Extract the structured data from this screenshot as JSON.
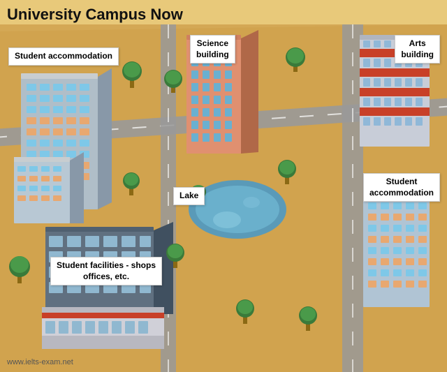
{
  "title": "University Campus Now",
  "labels": {
    "student_accommodation_left": "Student\naccommodation",
    "science_building": "Science\nbuilding",
    "arts_building": "Arts\nbuilding",
    "lake": "Lake",
    "student_facilities": "Student facilities - shops\noffices, etc.",
    "student_accommodation_right": "Student\naccommodation"
  },
  "watermark": "www.ielts-exam.net",
  "colors": {
    "ground": "#d4a855",
    "road": "#888888",
    "lake": "#5a9ab8",
    "building_science_front": "#e8a080",
    "building_science_side": "#c07858",
    "building_arts_front": "#c8d0d8",
    "building_student_front": "#c8d8e8",
    "tree_canopy": "#3a7a3a",
    "tree_trunk": "#8B6914"
  }
}
